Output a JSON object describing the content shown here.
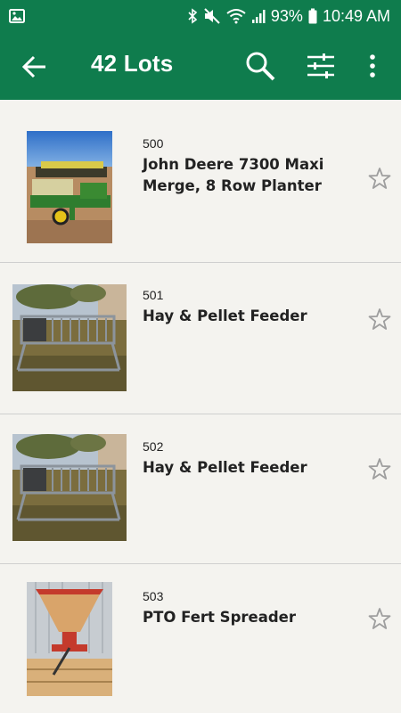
{
  "status_bar": {
    "battery": "93%",
    "time": "10:49 AM",
    "icons": [
      "image-icon",
      "bluetooth-icon",
      "mute-icon",
      "wifi-icon",
      "signal-icon",
      "battery-icon"
    ]
  },
  "app_bar": {
    "title": "42 Lots",
    "icons": [
      "back-arrow-icon",
      "search-icon",
      "filter-icon",
      "more-vert-icon"
    ]
  },
  "lots": [
    {
      "number": "500",
      "title": "John Deere 7300 Maxi Merge, 8 Row Planter",
      "image": "planter-photo"
    },
    {
      "number": "501",
      "title": "Hay & Pellet Feeder",
      "image": "feeder-photo"
    },
    {
      "number": "502",
      "title": "Hay & Pellet Feeder",
      "image": "feeder-photo"
    },
    {
      "number": "503",
      "title": "PTO Fert Spreader",
      "image": "spreader-photo"
    }
  ],
  "colors": {
    "primary": "#0f7c4d",
    "background": "#f4f3ef",
    "divider": "#cfcfcf",
    "text": "#222222",
    "star_outline": "#9e9e9e"
  }
}
